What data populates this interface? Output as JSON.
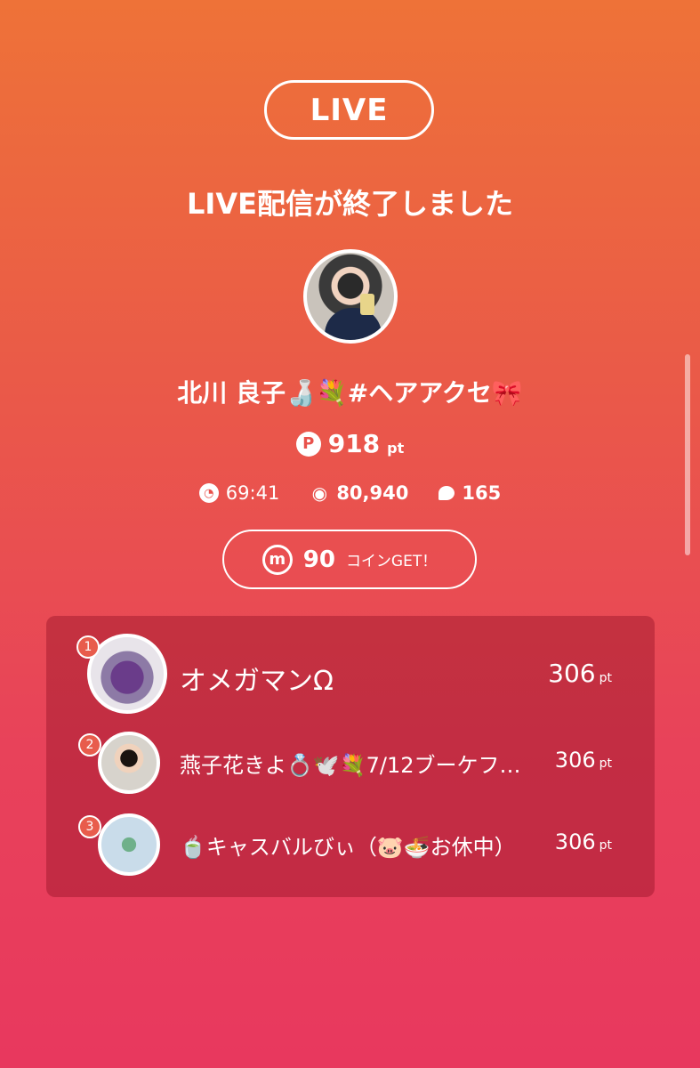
{
  "header": {
    "badge": "LIVE",
    "title": "LIVE配信が終了しました"
  },
  "host": {
    "name": "北川 良子🍶💐#ヘアアクセ🎀",
    "points_icon": "P",
    "points": "918",
    "points_unit": "pt"
  },
  "stats": {
    "duration_icon": "clock-icon",
    "duration": "69:41",
    "views_icon": "eye-icon",
    "views": "80,940",
    "comments_icon": "comment-icon",
    "comments": "165"
  },
  "coin": {
    "icon": "m",
    "amount": "90",
    "label": "コインGET！"
  },
  "ranking": [
    {
      "rank": "1",
      "name": "オメガマンΩ",
      "points": "306",
      "unit": "pt"
    },
    {
      "rank": "2",
      "name": "燕子花きよ💍🕊️💐7/12ブーケフ…",
      "points": "306",
      "unit": "pt"
    },
    {
      "rank": "3",
      "name": "🍵キャスバルびぃ（🐷🍜お休中）",
      "points": "306",
      "unit": "pt"
    }
  ],
  "colors": {
    "gradient_top": "#ee7238",
    "gradient_bottom": "#e8385e",
    "accent": "#e85c4c"
  }
}
